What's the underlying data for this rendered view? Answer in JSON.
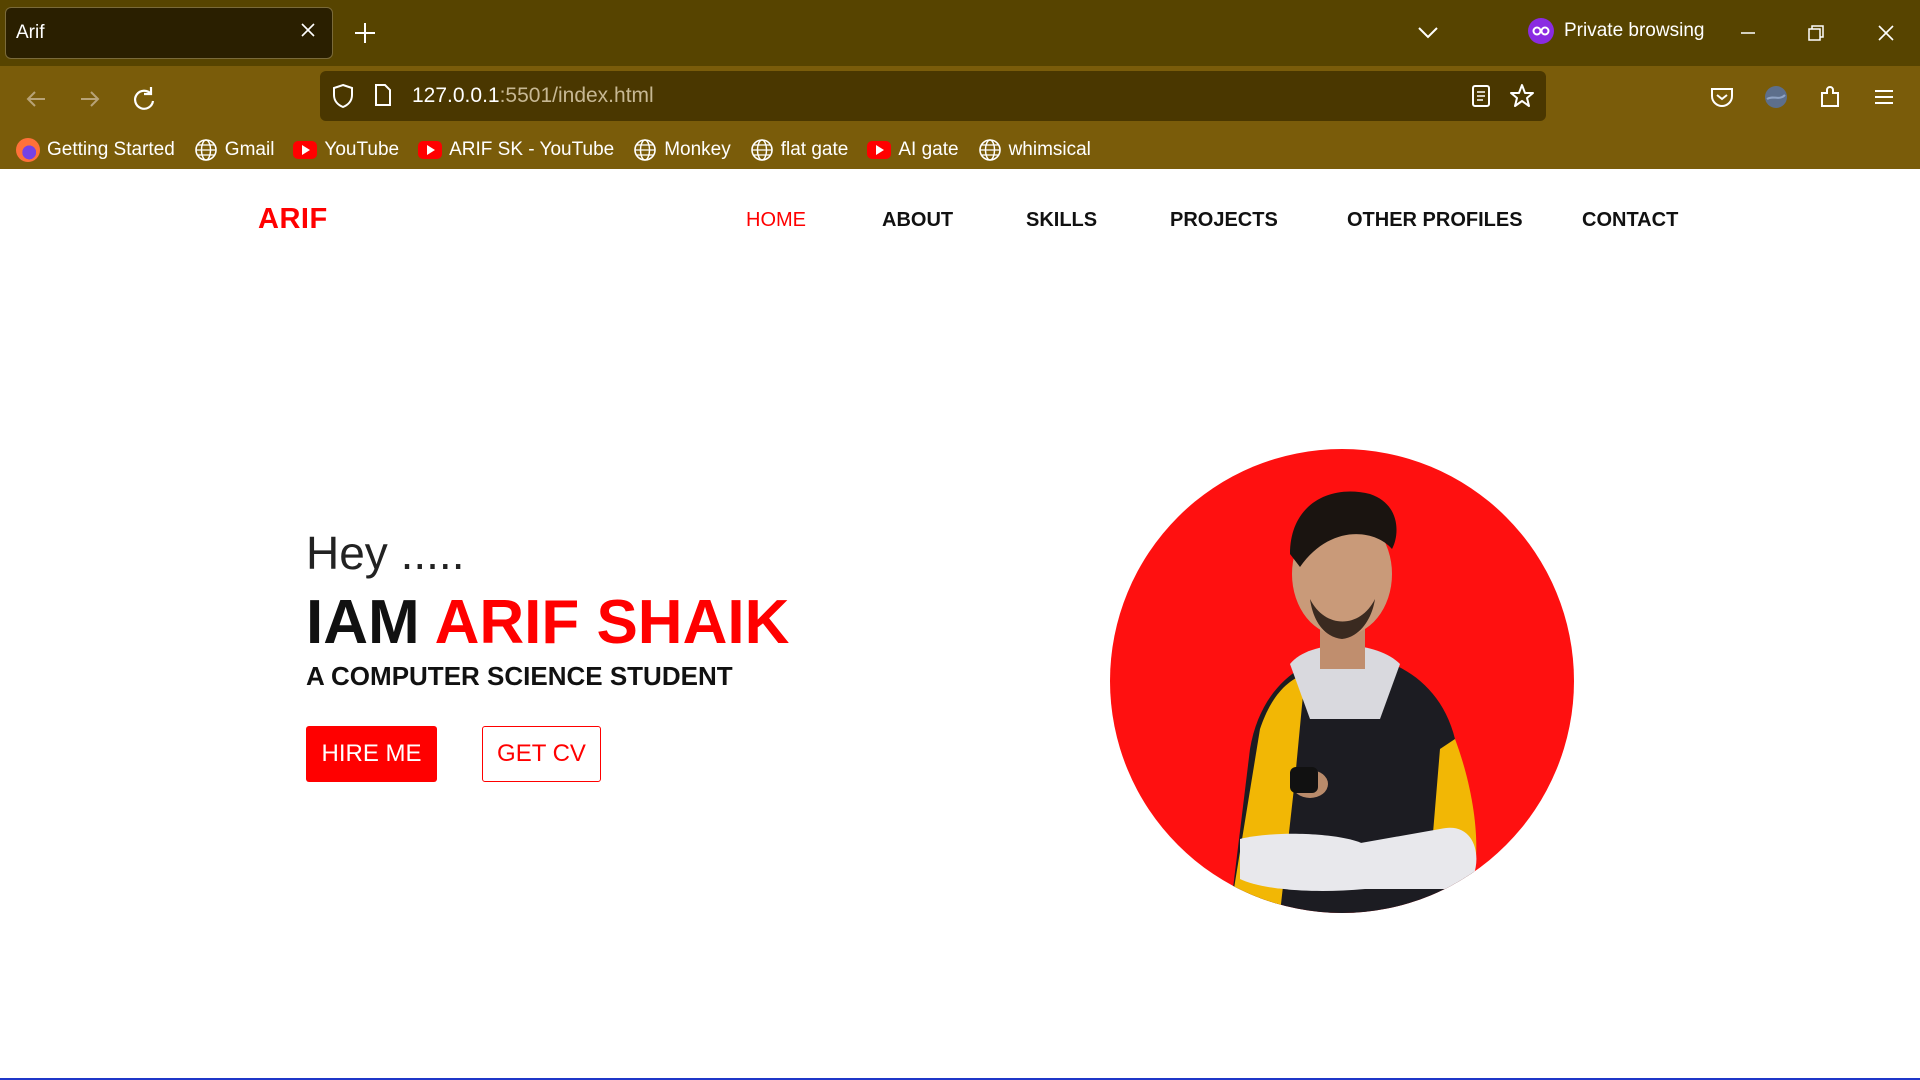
{
  "browser": {
    "tab_title": "Arif",
    "private_label": "Private browsing",
    "url_host": "127.0.0.1",
    "url_rest": ":5501/index.html",
    "bookmarks": [
      {
        "label": "Getting Started",
        "icon": "firefox-icon"
      },
      {
        "label": "Gmail",
        "icon": "globe-icon"
      },
      {
        "label": "YouTube",
        "icon": "youtube-icon"
      },
      {
        "label": "ARIF SK - YouTube",
        "icon": "youtube-icon"
      },
      {
        "label": "Monkey",
        "icon": "globe-icon"
      },
      {
        "label": "flat gate",
        "icon": "globe-icon"
      },
      {
        "label": "AI gate",
        "icon": "youtube-icon"
      },
      {
        "label": "whimsical",
        "icon": "globe-icon"
      }
    ]
  },
  "site": {
    "logo": "ARIF",
    "nav": [
      "HOME",
      "ABOUT",
      "SKILLS",
      "PROJECTS",
      "OTHER PROFILES",
      "CONTACT"
    ],
    "active_nav": "HOME",
    "hero": {
      "greeting": "Hey .....",
      "iam": "IAM ",
      "name": "ARIF SHAIK",
      "subtitle": "A COMPUTER SCIENCE STUDENT",
      "hire_label": "HIRE ME",
      "cv_label": "GET CV"
    },
    "accent_color": "#ff0000"
  }
}
